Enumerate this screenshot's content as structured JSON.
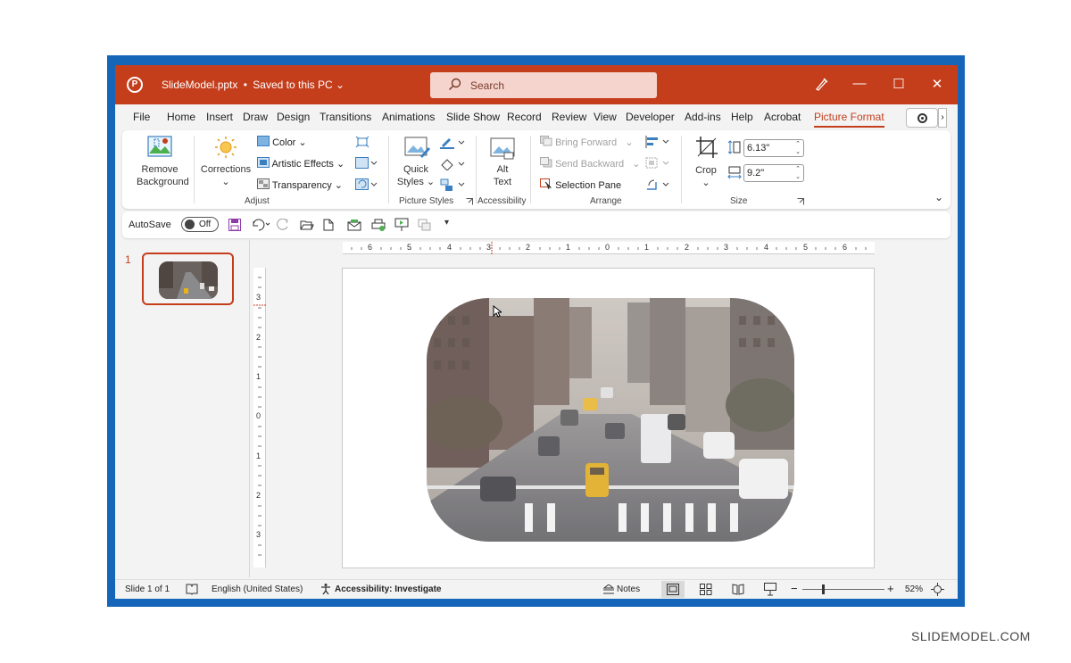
{
  "titlebar": {
    "doc_name": "SlideModel.pptx",
    "separator": "•",
    "save_status": "Saved to this PC",
    "search_placeholder": "Search",
    "accent": "#c43e1c"
  },
  "tabs": [
    "File",
    "Home",
    "Insert",
    "Draw",
    "Design",
    "Transitions",
    "Animations",
    "Slide Show",
    "Record",
    "Review",
    "View",
    "Developer",
    "Add-ins",
    "Help",
    "Acrobat",
    "Picture Format"
  ],
  "active_tab": "Picture Format",
  "ribbon": {
    "remove_bg_line1": "Remove",
    "remove_bg_line2": "Background",
    "corrections": "Corrections",
    "color": "Color",
    "artistic_effects": "Artistic Effects",
    "transparency": "Transparency",
    "adjust_label": "Adjust",
    "quick_line1": "Quick",
    "quick_line2": "Styles",
    "picture_styles_label": "Picture Styles",
    "alt_line1": "Alt",
    "alt_line2": "Text",
    "accessibility_label": "Accessibility",
    "bring_forward": "Bring Forward",
    "send_backward": "Send Backward",
    "selection_pane": "Selection Pane",
    "arrange_label": "Arrange",
    "crop": "Crop",
    "height_value": "6.13\"",
    "width_value": "9.2\"",
    "size_label": "Size"
  },
  "qat": {
    "autosave_label": "AutoSave",
    "autosave_state": "Off"
  },
  "thumbnails": {
    "slide_number": "1"
  },
  "ruler": {
    "h_labels": [
      "6",
      "5",
      "4",
      "3",
      "2",
      "1",
      "0",
      "1",
      "2",
      "3",
      "4",
      "5",
      "6"
    ],
    "v_labels": [
      "3",
      "2",
      "1",
      "0",
      "1",
      "2",
      "3"
    ]
  },
  "statusbar": {
    "slide_info": "Slide 1 of 1",
    "language": "English (United States)",
    "accessibility": "Accessibility: Investigate",
    "notes": "Notes",
    "zoom": "52%"
  },
  "watermark": "SLIDEMODEL.COM"
}
